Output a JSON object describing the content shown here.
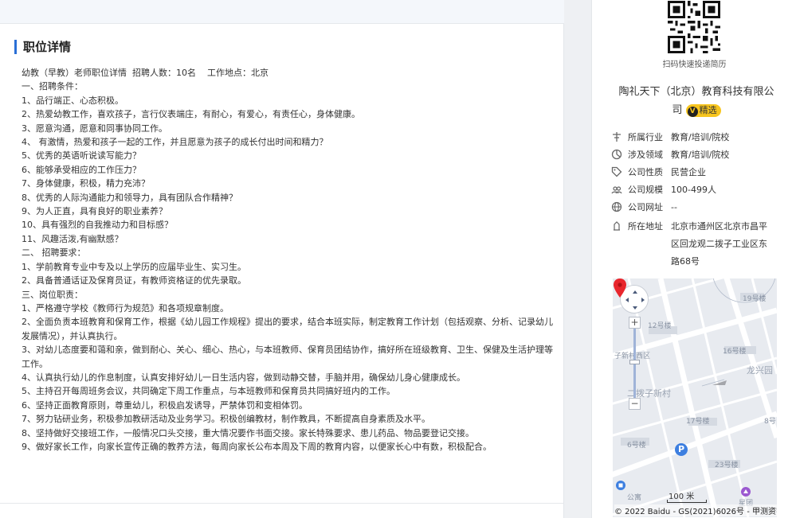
{
  "job_section": {
    "title": "职位详情",
    "lines": [
      "幼教（早教）老师职位详情  招聘人数：10名    工作地点：北京",
      "一、招聘条件：",
      "1、品行端正、心态积极。",
      "2、热爱幼教工作，喜欢孩子，言行仪表端庄，有耐心，有爱心，有责任心，身体健康。",
      "3、愿意沟通，愿意和同事协同工作。",
      "4、 有激情，热爱和孩子一起的工作，并且愿意为孩子的成长付出时间和精力？",
      "5、优秀的英语听说读写能力？",
      "6、能够承受相应的工作压力？",
      "7、身体健康，积极，精力充沛？",
      "8、优秀的人际沟通能力和领导力，具有团队合作精神？",
      "9、为人正直，具有良好的职业素养？",
      "10、具有强烈的自我推动力和目标感？",
      "11、风趣活泼,有幽默感？",
      "二、 招聘要求：",
      "1、学前教育专业中专及以上学历的应届毕业生、实习生。",
      "2、具备普通话证及保育员证，有教师资格证的优先录取。",
      "三、岗位职责：",
      "1、严格遵守学校《教师行为规范》和各项规章制度。",
      "2、全面负责本班教育和保育工作，根据《幼儿园工作规程》提出的要求，结合本班实际，制定教育工作计划（包括观察、分析、记录幼儿发展情况），并认真执行。",
      "3、对幼儿态度要和蔼和亲，做到耐心、关心、细心、热心，与本班教师、保育员团结协作，搞好所在班级教育、卫生、保健及生活护理等工作。",
      "4、认真执行幼儿的作息制度，认真安排好幼儿一日生活内容，做到动静交替，手脑并用，确保幼儿身心健康成长。",
      "5、主持召开每周班务会议，共同确定下周工作重点，与本班教师和保育员共同搞好班内的工作。",
      "6、坚持正面教育原则，尊重幼儿，积极启发诱导，严禁体罚和变相体罚。",
      "7、努力钻研业务，积极参加教研活动及业务学习。积极创编教材，制作教具，不断提高自身素质及水平。",
      "8、坚持做好交接班工作，一般情况口头交接，重大情况要作书面交接。家长特殊要求、患儿药品、物品要登记交接。",
      "9、做好家长工作，向家长宣传正确的教养方法，每周向家长公布本周及下周的教育内容，以便家长心中有数，积极配合。"
    ]
  },
  "sidebar": {
    "qr_caption": "扫码快速投递简历",
    "company_name": "陶礼天下（北京）教育科技有限公司",
    "badge": "精选",
    "badge_icon": "V",
    "info": [
      {
        "icon": "industry-icon",
        "label": "所属行业",
        "value": "教育/培训/院校"
      },
      {
        "icon": "domain-icon",
        "label": "涉及领域",
        "value": "教育/培训/院校"
      },
      {
        "icon": "tag-icon",
        "label": "公司性质",
        "value": "民营企业"
      },
      {
        "icon": "people-icon",
        "label": "公司规模",
        "value": "100-499人"
      },
      {
        "icon": "globe-icon",
        "label": "公司网址",
        "value": "--"
      },
      {
        "icon": "address-icon",
        "label": "所在地址",
        "value": ""
      }
    ],
    "address": "北京市通州区北京市昌平区回龙观二拨子工业区东路68号"
  },
  "map": {
    "labels": [
      "19号楼",
      "12号楼",
      "16号楼",
      "子新村西区",
      "龙兴园",
      "二拨子新村",
      "17号楼",
      "8号",
      "6号楼",
      "23号楼",
      "公寓",
      "星团"
    ],
    "scale": "100 米",
    "copyright": "© 2022 Baidu - GS(2021)6026号 - 甲测资字",
    "zoom_in": "+",
    "zoom_out": "−",
    "parking": "P",
    "pin_color": "#e8262d"
  }
}
